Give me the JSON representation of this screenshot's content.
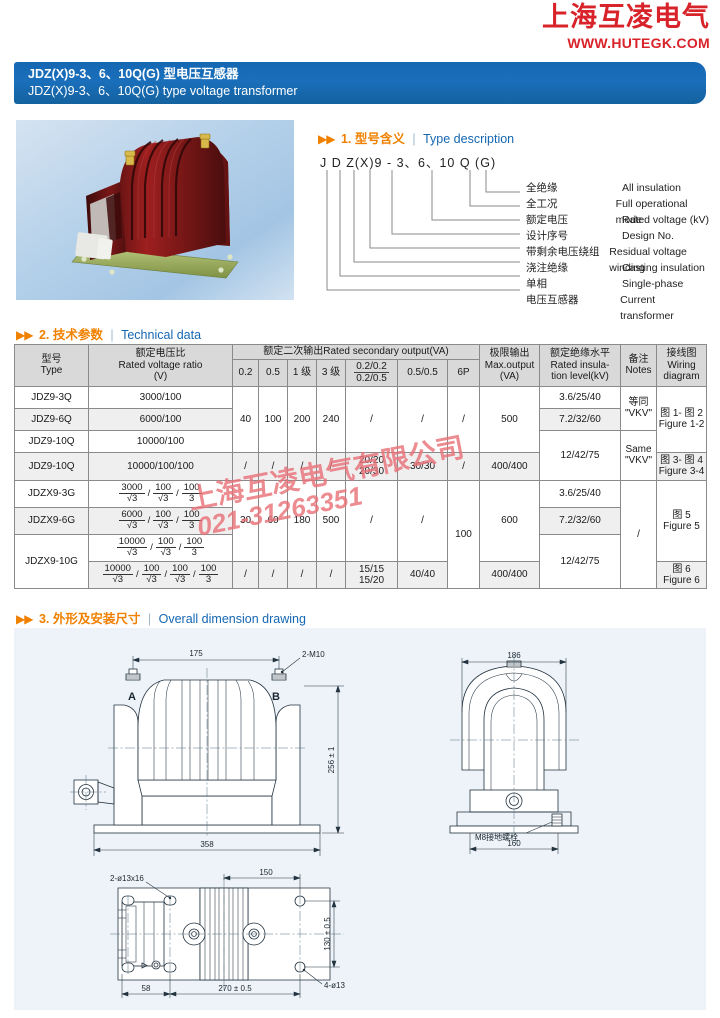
{
  "brand": {
    "company_cn": "上海互凌电气",
    "website": "WWW.HUTEGK.COM",
    "accent_red": "#d8232a",
    "accent_blue": "#1567b2",
    "accent_orange": "#f08000"
  },
  "banner": {
    "title_cn": "JDZ(X)9-3、6、10Q(G) 型电压互感器",
    "title_cn_bold": "JDZ(X)9-3、6、10Q(G)",
    "title_cn_rest": " 型电压互感器",
    "title_en": "JDZ(X)9-3、6、10Q(G)  type voltage transformer"
  },
  "sections": [
    {
      "num": "1.",
      "cn": "型号含义",
      "en": "Type description"
    },
    {
      "num": "2.",
      "cn": "技术参数",
      "en": "Technical data"
    },
    {
      "num": "3.",
      "cn": "外形及安装尺寸",
      "en": "Overall dimension drawing"
    }
  ],
  "type_description": {
    "code": "J D Z(X)9 - 3、6、10 Q (G)",
    "legend": [
      {
        "cn": "全绝缘",
        "en": "All insulation"
      },
      {
        "cn": "全工况",
        "en": "Full operational mode"
      },
      {
        "cn": "额定电压",
        "en": "Rated voltage (kV)"
      },
      {
        "cn": "设计序号",
        "en": "Design No."
      },
      {
        "cn": "带剩余电压绕组",
        "en": "Residual voltage winding"
      },
      {
        "cn": "浇注绝缘",
        "en": "Casting insulation"
      },
      {
        "cn": "单相",
        "en": "Single-phase"
      },
      {
        "cn": "电压互感器",
        "en": "Current transformer"
      }
    ]
  },
  "technical_data": {
    "headers": {
      "type_cn": "型号",
      "type_en": "Type",
      "ratio_cn": "额定电压比",
      "ratio_en": "Rated voltage ratio",
      "ratio_unit": "(V)",
      "secondary_group": "额定二次输出Rated secondary output(VA)",
      "sub": [
        "0.2",
        "0.5",
        "1 级",
        "3 级",
        "0.2/0.2",
        "0.2/0.5",
        "0.5/0.5",
        "6P"
      ],
      "max_cn": "极限输出",
      "max_en": "Max.output",
      "max_unit": "(VA)",
      "insul_cn": "额定绝缘水平",
      "insul_en1": "Rated insula-",
      "insul_en2": "tion level(kV)",
      "notes_cn": "备注",
      "notes_en": "Notes",
      "wiring_cn": "接线图",
      "wiring_en1": "Wiring",
      "wiring_en2": "diagram"
    },
    "rows": [
      {
        "type": "JDZ9-3Q",
        "ratio_plain": "3000/100",
        "c02": "40",
        "c05": "100",
        "c1": "200",
        "c3": "240",
        "c0202": "/",
        "c0505": "/",
        "c6p": "/",
        "max": "500",
        "insul": "3.6/25/40",
        "notes": "等同\n\"VKV\"",
        "wiring": "图 1- 图 2\nFigure 1-2"
      },
      {
        "type": "JDZ9-6Q",
        "ratio_plain": "6000/100",
        "insul": "7.2/32/60"
      },
      {
        "type": "JDZ9-10Q",
        "ratio_plain": "10000/100",
        "insul": "12/42/75"
      },
      {
        "type": "JDZ9-10Q",
        "ratio_plain": "10000/100/100",
        "c02": "/",
        "c05": "/",
        "c1": "/",
        "c3": "/",
        "c0202": "20/20\n20/30",
        "c0505": "30/30",
        "c6p": "/",
        "max": "400/400",
        "insul": "12/42/75",
        "notes": "Same\n\"VKV\"",
        "wiring": "图 3- 图 4\nFigure 3-4"
      },
      {
        "type": "JDZX9-3G",
        "ratio_frac": [
          {
            "n": "3000",
            "d": "√3"
          },
          {
            "n": "100",
            "d": "√3"
          },
          {
            "n": "100",
            "d": "3"
          }
        ],
        "c02": "30",
        "c05": "60",
        "c1": "180",
        "c3": "500",
        "c0202": "/",
        "c0505": "/",
        "c6p": "100",
        "max": "600",
        "insul": "3.6/25/40",
        "notes": "/",
        "wiring": "图 5\nFigure 5"
      },
      {
        "type": "JDZX9-6G",
        "ratio_frac": [
          {
            "n": "6000",
            "d": "√3"
          },
          {
            "n": "100",
            "d": "√3"
          },
          {
            "n": "100",
            "d": "3"
          }
        ],
        "insul": "7.2/32/60"
      },
      {
        "type": "JDZX9-10G",
        "ratio_frac": [
          {
            "n": "10000",
            "d": "√3"
          },
          {
            "n": "100",
            "d": "√3"
          },
          {
            "n": "100",
            "d": "3"
          }
        ],
        "insul": "12/42/75"
      },
      {
        "type": "JDZX9-10G",
        "ratio_frac4": [
          {
            "n": "10000",
            "d": "√3"
          },
          {
            "n": "100",
            "d": "√3"
          },
          {
            "n": "100",
            "d": "√3"
          },
          {
            "n": "100",
            "d": "3"
          }
        ],
        "c02": "/",
        "c05": "/",
        "c1": "/",
        "c3": "/",
        "c0202": "15/15\n15/20",
        "c0505": "40/40",
        "c6p": "/",
        "max": "400/400",
        "insul": "12/42/75",
        "wiring": "图 6\nFigure 6"
      }
    ]
  },
  "dimensions": {
    "front_view": {
      "top_width": "175",
      "bolts": "2-M10",
      "terminal_a": "A",
      "terminal_b": "B",
      "height": "256 ± 1",
      "base_width": "358"
    },
    "side_view": {
      "width": "186",
      "ground_bolt": "M8接地螺栓",
      "base_width": "160"
    },
    "plan_view": {
      "slot_holes": "2-ø13x16",
      "hole_spacing": "150",
      "depth": "130 ± 0.5",
      "edge_dim": "58",
      "length": "270 ± 0.5",
      "holes": "4-ø13"
    }
  },
  "watermark": {
    "line1": "上海互凌电气有限公司",
    "line2": "021-31263351"
  }
}
